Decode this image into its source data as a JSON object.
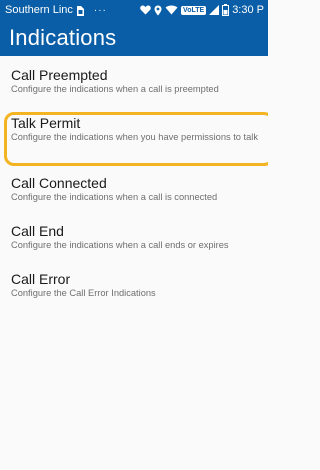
{
  "colors": {
    "accent": "#0a5ea7",
    "highlight": "#f4b321",
    "background": "#fafafa",
    "title_text": "#1a1a1a",
    "summary_text": "#6f6f6f"
  },
  "status_bar": {
    "carrier": "Southern Linc",
    "more": "···",
    "volte": "VoLTE",
    "time": "3:30 P",
    "icons": [
      "sim-icon",
      "heart-icon",
      "location-icon",
      "wifi-icon",
      "volte-icon",
      "signal-icon",
      "battery-icon"
    ]
  },
  "header": {
    "title": "Indications"
  },
  "items": [
    {
      "title": "Call Preempted",
      "summary": "Configure the indications when a call is preempted"
    },
    {
      "title": "Talk Permit",
      "summary": "Configure the indications when you have permissions to talk"
    },
    {
      "title": "Call Connected",
      "summary": "Configure the indications when a call is connected"
    },
    {
      "title": "Call End",
      "summary": "Configure the indications when a call ends or expires"
    },
    {
      "title": "Call Error",
      "summary": "Configure the Call Error Indications"
    }
  ]
}
